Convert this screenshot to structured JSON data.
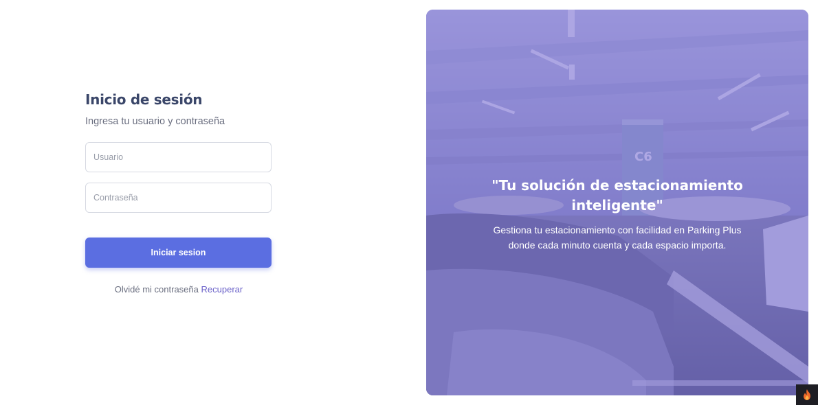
{
  "login": {
    "title": "Inicio de sesión",
    "subtitle": "Ingresa tu usuario y contraseña",
    "username_placeholder": "Usuario",
    "password_placeholder": "Contraseña",
    "submit_label": "Iniciar sesion",
    "forgot_text": "Olvidé mi contraseña",
    "recover_link": "Recuperar"
  },
  "hero": {
    "quote": "\"Tu solución de estacionamiento inteligente\"",
    "description": "Gestiona tu estacionamiento con facilidad en Parking Plus donde cada minuto cuenta y cada espacio importa.",
    "pillar_label": "C6"
  },
  "colors": {
    "accent": "#5b6ee1",
    "link": "#6b62c9",
    "heading": "#3a4669",
    "overlay": "#6e60cd"
  },
  "icons": {
    "corner_badge": "flame-icon"
  }
}
